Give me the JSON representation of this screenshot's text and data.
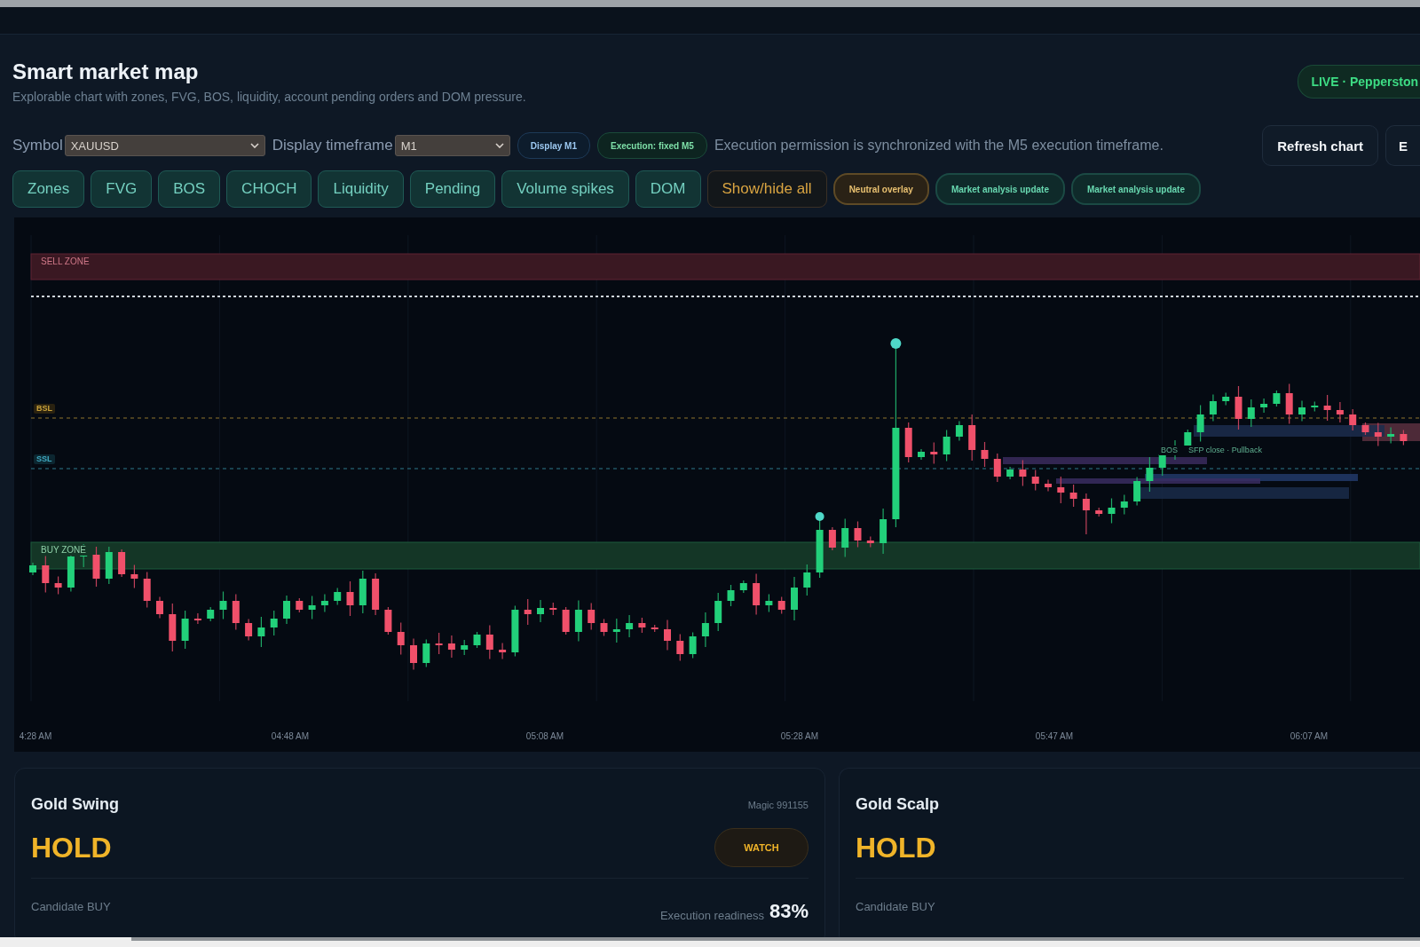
{
  "header": {
    "title": "Smart market map",
    "subtitle": "Explorable chart with zones, FVG, BOS, liquidity, account pending orders and DOM pressure.",
    "live_badge": "LIVE · Pepperston"
  },
  "controls": {
    "symbol": {
      "label": "Symbol",
      "value": "XAUUSD"
    },
    "timeframe": {
      "label": "Display timeframe",
      "value": "M1"
    },
    "badges": [
      {
        "kind": "display",
        "label": "Display M1"
      },
      {
        "kind": "execution",
        "label": "Execution: fixed M5"
      }
    ],
    "note": "Execution permission is synchronized with the M5 execution timeframe.",
    "buttons": [
      "Refresh chart",
      "E"
    ]
  },
  "layer_toggles": [
    {
      "label": "Zones",
      "on": true
    },
    {
      "label": "FVG",
      "on": true
    },
    {
      "label": "BOS",
      "on": true
    },
    {
      "label": "CHOCH",
      "on": true
    },
    {
      "label": "Liquidity",
      "on": true
    },
    {
      "label": "Pending",
      "on": true
    },
    {
      "label": "Volume spikes",
      "on": true
    },
    {
      "label": "DOM",
      "on": true
    }
  ],
  "show_hide_all": "Show/hide all",
  "status_pills": [
    {
      "kind": "warning",
      "label": "Neutral overlay"
    },
    {
      "kind": "info",
      "label": "Market analysis update"
    },
    {
      "kind": "info",
      "label": "Market analysis update"
    }
  ],
  "chart": {
    "zones": [
      {
        "kind": "sell",
        "label": "SELL ZONE"
      },
      {
        "kind": "buy",
        "label": "BUY ZONE"
      }
    ],
    "levels": [
      {
        "kind": "buy_side",
        "label": "BSL"
      },
      {
        "kind": "sell_side",
        "label": "SSL"
      }
    ],
    "annotations": [
      "BOS",
      "SFP close · Pullback"
    ],
    "time_labels": [
      "4:28 AM",
      "04:48 AM",
      "05:08 AM",
      "05:28 AM",
      "05:47 AM",
      "06:07 AM"
    ]
  },
  "cards": [
    {
      "title": "Gold Swing",
      "magic": "Magic 991155",
      "signal": "HOLD",
      "badge": "WATCH",
      "candidate": "Candidate BUY",
      "readiness_label": "Execution readiness",
      "readiness": "83%"
    },
    {
      "title": "Gold Scalp",
      "signal": "HOLD",
      "candidate": "Candidate BUY"
    }
  ]
}
